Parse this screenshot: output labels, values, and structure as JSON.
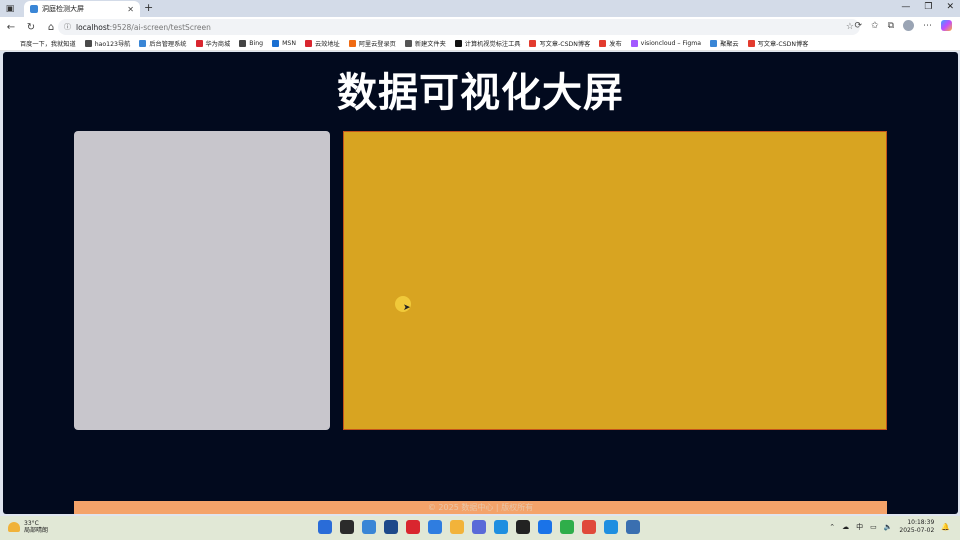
{
  "browser": {
    "tab_title": "洞庭检测大屏",
    "new_tab": "+",
    "url_host": "localhost",
    "url_path": ":9528/ai-screen/testScreen",
    "window_controls": [
      "—",
      "❐",
      "✕"
    ]
  },
  "bookmarks": [
    {
      "label": "百度一下，我就知道",
      "color": "#ffffff"
    },
    {
      "label": "hao123导航",
      "color": "#4a4a4a"
    },
    {
      "label": "后台管理系统",
      "color": "#3a86d6"
    },
    {
      "label": "华为商城",
      "color": "#d9262f"
    },
    {
      "label": "Bing",
      "color": "#444444"
    },
    {
      "label": "MSN",
      "color": "#1a6fd1"
    },
    {
      "label": "云效地址",
      "color": "#d9262f"
    },
    {
      "label": "阿里云登录页",
      "color": "#f06a12"
    },
    {
      "label": "新建文件夹",
      "color": "#555555"
    },
    {
      "label": "计算机视觉标注工具",
      "color": "#111111"
    },
    {
      "label": "写文章-CSDN博客",
      "color": "#e33b2e"
    },
    {
      "label": "发布",
      "color": "#e33b2e"
    },
    {
      "label": "visioncloud – Figma",
      "color": "#a259ff"
    },
    {
      "label": "聚聚云",
      "color": "#3a86d6"
    },
    {
      "label": "写文章-CSDN博客",
      "color": "#e33b2e"
    }
  ],
  "page": {
    "title": "数据可视化大屏",
    "footer": "© 2025 数据中心 | 版权所有"
  },
  "taskbar": {
    "temperature": "33°C",
    "weather": "局部晴朗",
    "ime": "中",
    "time": "10:18:39",
    "date": "2025-07-02",
    "apps": [
      "#2a6cd8",
      "#2b2b2b",
      "#3a86d6",
      "#1e4a8a",
      "#d9262f",
      "#2f7de0",
      "#f2b33a",
      "#5a6ad8",
      "#1f8fe0",
      "#222222",
      "#1a73e8",
      "#2fae4a",
      "#e04a3a",
      "#1f8fe0",
      "#3a6fb0"
    ]
  }
}
